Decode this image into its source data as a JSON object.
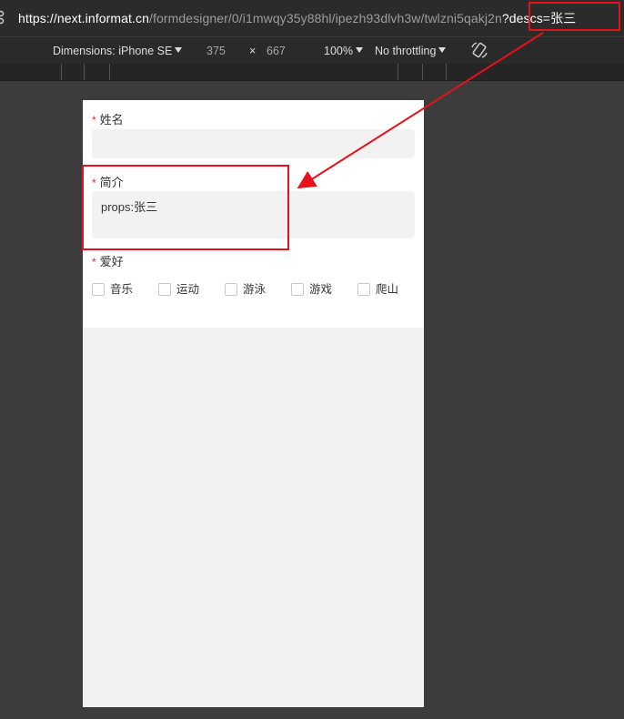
{
  "browser": {
    "url_host": "https://next.informat.cn",
    "url_path": "/formdesigner/0/i1mwqy35y88hl/ipezh93dlvh3w/twlzni5qakj2n",
    "url_query": "?descs=张三"
  },
  "devtools": {
    "device_label": "Dimensions: iPhone SE",
    "width": "375",
    "times": "×",
    "height": "667",
    "zoom": "100%",
    "throttling": "No throttling",
    "rotate_icon": "rotate-icon"
  },
  "form": {
    "name_label": "姓名",
    "name_value": "",
    "desc_label": "简介",
    "desc_value": "props:张三",
    "hobby_label": "爱好",
    "required_mark": "*",
    "hobbies": [
      "音乐",
      "运动",
      "游泳",
      "游戏",
      "爬山"
    ]
  },
  "colors": {
    "annotation": "#e8111b",
    "required": "#f5222d"
  }
}
